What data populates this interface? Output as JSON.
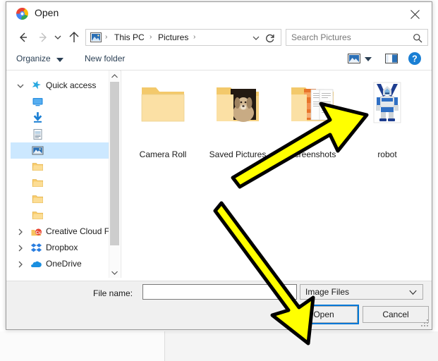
{
  "window": {
    "title": "Open",
    "app_icon": "chrome-icon",
    "close_label": "✕"
  },
  "nav": {
    "back_icon": "arrow-left-icon",
    "forward_icon": "arrow-right-icon",
    "recent_icon": "chevron-down-icon",
    "up_icon": "arrow-up-icon",
    "refresh_icon": "refresh-icon",
    "address_icon": "pictures-folder-icon",
    "breadcrumb": [
      "This PC",
      "Pictures"
    ],
    "breadcrumb_separator": "›"
  },
  "search": {
    "placeholder": "Search Pictures",
    "icon": "search-icon"
  },
  "toolbar": {
    "organize_label": "Organize",
    "organize_caret": "▼",
    "new_folder_label": "New folder",
    "view_icon": "view-layout-icon",
    "view_caret": "▼",
    "preview_pane_icon": "preview-pane-icon",
    "help_icon": "help-icon",
    "help_glyph": "?"
  },
  "sidebar": {
    "items": [
      {
        "label": "Quick access",
        "icon": "star-pin-icon",
        "chevron": "expanded",
        "level": 0,
        "selected": false
      },
      {
        "label": "",
        "icon": "desktop-icon",
        "chevron": "none",
        "level": 1,
        "selected": false
      },
      {
        "label": "",
        "icon": "downloads-icon",
        "chevron": "none",
        "level": 1,
        "selected": false
      },
      {
        "label": "",
        "icon": "documents-icon",
        "chevron": "none",
        "level": 1,
        "selected": false
      },
      {
        "label": "",
        "icon": "pictures-icon",
        "chevron": "none",
        "level": 1,
        "selected": true
      },
      {
        "label": "",
        "icon": "folder-icon",
        "chevron": "none",
        "level": 1,
        "selected": false
      },
      {
        "label": "",
        "icon": "folder-icon",
        "chevron": "none",
        "level": 1,
        "selected": false
      },
      {
        "label": "",
        "icon": "folder-icon",
        "chevron": "none",
        "level": 1,
        "selected": false
      },
      {
        "label": "",
        "icon": "folder-icon",
        "chevron": "none",
        "level": 1,
        "selected": false
      },
      {
        "label": "Creative Cloud Fil",
        "icon": "creative-cloud-icon",
        "chevron": "collapsed",
        "level": 0,
        "selected": false
      },
      {
        "label": "Dropbox",
        "icon": "dropbox-icon",
        "chevron": "collapsed",
        "level": 0,
        "selected": false
      },
      {
        "label": "OneDrive",
        "icon": "onedrive-icon",
        "chevron": "collapsed",
        "level": 0,
        "selected": false
      }
    ],
    "scroll_up_icon": "chevron-up-icon",
    "scroll_down_icon": "chevron-down-icon"
  },
  "files": [
    {
      "name": "Camera Roll",
      "type": "folder",
      "thumb": "empty-folder"
    },
    {
      "name": "Saved Pictures",
      "type": "folder",
      "thumb": "dog-photo"
    },
    {
      "name": "Screenshots",
      "type": "folder",
      "thumb": "documents-photo"
    },
    {
      "name": "robot",
      "type": "image",
      "thumb": "robot-image"
    }
  ],
  "footer": {
    "file_name_label": "File name:",
    "file_name_value": "",
    "file_type_value": "Image Files",
    "file_type_caret": "∨",
    "open_label": "Open",
    "cancel_label": "Cancel",
    "resize_grip_icon": "resize-grip-icon"
  },
  "annotations": [
    {
      "name": "arrow-to-robot",
      "color": "#ffff00",
      "outline": "#000000"
    },
    {
      "name": "arrow-to-open-button",
      "color": "#ffff00",
      "outline": "#000000"
    }
  ],
  "colors": {
    "accent": "#0078d7",
    "selection": "#cce8ff",
    "dialog_bg": "#f0f0f0",
    "annotation": "#ffff00"
  }
}
